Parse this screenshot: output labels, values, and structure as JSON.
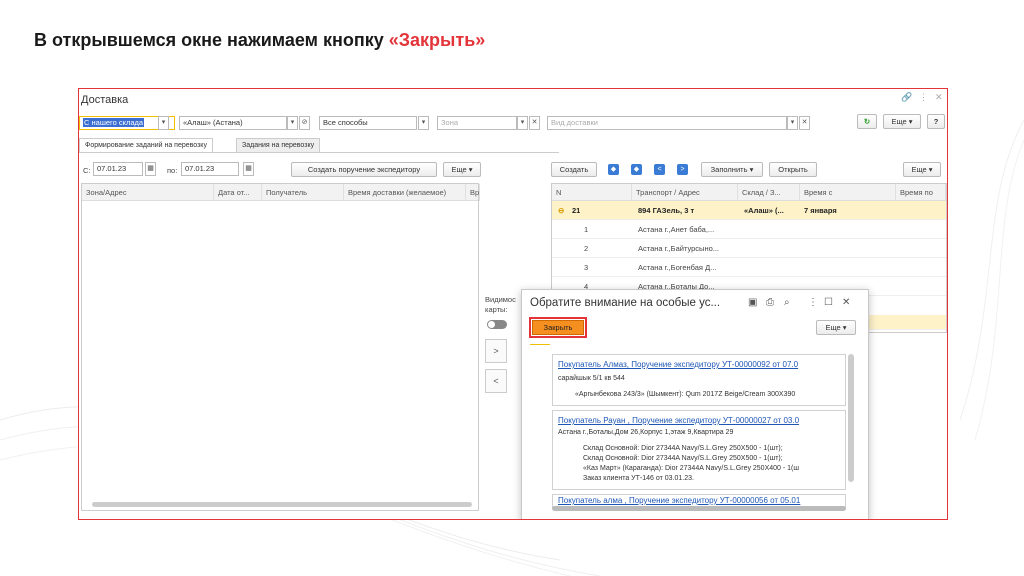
{
  "slide": {
    "title_main": "В открывшемся окне нажимаем кнопку ",
    "title_accent": "«Закрыть»",
    "accent_color": "#e3343a"
  },
  "window": {
    "title": "Доставка",
    "icons": [
      "link-icon",
      "more-icon",
      "close-icon"
    ]
  },
  "filters": {
    "warehouse": "С нашего склада",
    "warehouse_sq": "▾",
    "org": "«Алаш» (Астана)",
    "method": "Все способы",
    "zone_placeholder": "Зона",
    "type_placeholder": "Вид доставки",
    "more": "Еще",
    "help": "?"
  },
  "tabs": [
    "Формирование заданий на перевозку",
    "Задания на перевозку"
  ],
  "left": {
    "from_label": "С:",
    "from_value": "07.01.23",
    "to_label": "по:",
    "to_value": "07.01.23",
    "create_btn": "Создать поручение экспедитору",
    "more": "Еще",
    "columns": [
      "Зона/Адрес",
      "Дата от...",
      "Получатель",
      "Время доставки (желаемое)",
      "Вр"
    ]
  },
  "right": {
    "create": "Создать",
    "fill": "Заполнить",
    "open": "Открыть",
    "more": "Еще",
    "columns": [
      "N",
      "Транспорт / Адрес",
      "Склад / З...",
      "Время с",
      "Время по"
    ],
    "rows": [
      {
        "n": "21",
        "addr": "894 ГАЗель, 3 т",
        "wh": "«Алаш» (...",
        "time": "7 января",
        "highlight": true
      },
      {
        "n": "1",
        "addr": "Астана г.,Анет баба,...",
        "wh": "",
        "time": "",
        "highlight": false
      },
      {
        "n": "2",
        "addr": "Астана г.,Байтурсыно...",
        "wh": "",
        "time": "",
        "highlight": false
      },
      {
        "n": "3",
        "addr": "Астана г.,Богенбая Д...",
        "wh": "",
        "time": "",
        "highlight": false
      },
      {
        "n": "4",
        "addr": "Астана г.,Боталы До...",
        "wh": "",
        "time": "",
        "highlight": false
      }
    ]
  },
  "middle": {
    "map_label_1": "Видимос",
    "map_label_2": "карты:",
    "forward": ">",
    "back": "<"
  },
  "dialog": {
    "title": "Обратите внимание на особые ус...",
    "close_button": "Закрыть",
    "more": "Еще",
    "cards": [
      {
        "link": "Покупатель Алмаз, Поручение экспедитору УТ-00000092 от 07.0",
        "address": "сарайшык 5/1 кв 544",
        "lines": [
          "«Аргынбекова 243/3» (Шымкент): Qum 2017Z Beige/Cream 300X390"
        ]
      },
      {
        "link": "Покупатель Рауан , Поручение экспедитору УТ-00000027 от 03.0",
        "address": "Астана г.,Боталы,Дом 26,Корпус 1,этаж 9,Квартира 29",
        "lines": [
          "Склад Основной: Dior 27344A Navy/S.L.Grey 250X500  - 1(шт);",
          "Склад Основной: Dior 27344A Navy/S.L.Grey 250X500  - 1(шт);",
          "«Каз Март» (Караганда): Dior 27344A Navy/S.L.Grey 250X400  - 1(ш",
          "Заказ клиента УТ-146 от 03.01.23."
        ]
      },
      {
        "link": "Покупатель алма , Поручение экспедитору УТ-00000056 от 05.01",
        "address": "",
        "lines": []
      }
    ]
  }
}
